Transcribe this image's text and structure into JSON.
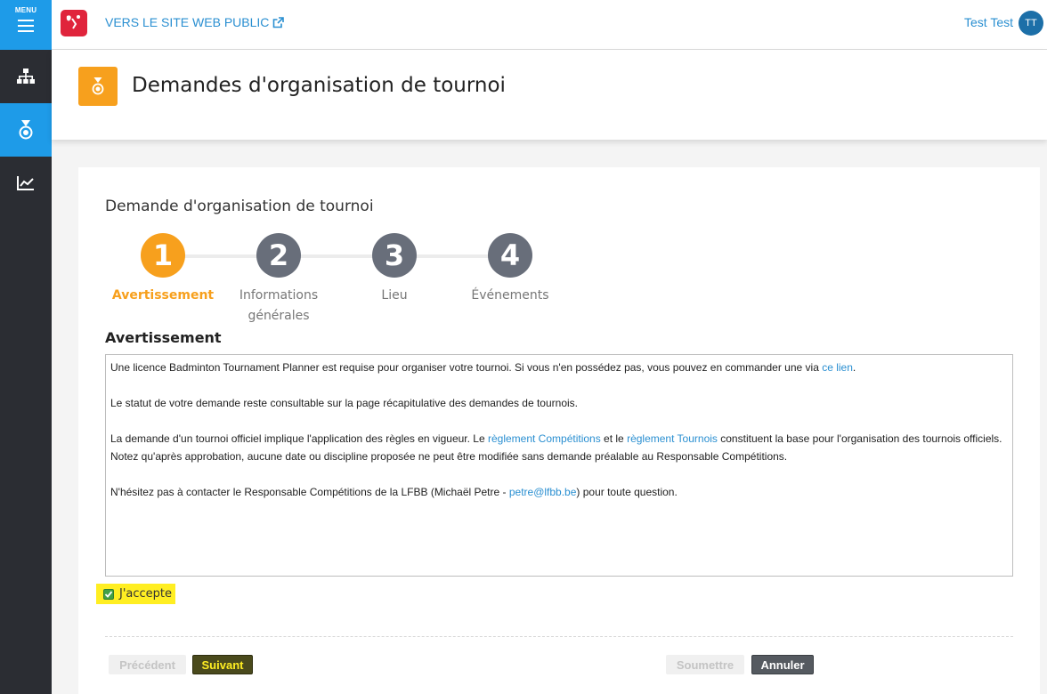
{
  "sidebar": {
    "menu_label": "MENU",
    "items": [
      {
        "icon": "sitemap-icon"
      },
      {
        "icon": "medal-icon"
      },
      {
        "icon": "line-chart-icon"
      }
    ]
  },
  "header": {
    "logo_text": "lfbb",
    "public_link": "VERS LE SITE WEB PUBLIC",
    "user_name": "Test Test",
    "user_initials": "TT"
  },
  "page": {
    "title": "Demandes d'organisation de tournoi"
  },
  "card": {
    "title": "Demande d'organisation de tournoi",
    "steps": [
      {
        "number": "1",
        "label": "Avertissement"
      },
      {
        "number": "2",
        "label": "Informations générales"
      },
      {
        "number": "3",
        "label": "Lieu"
      },
      {
        "number": "4",
        "label": "Événements"
      }
    ],
    "section_heading": "Avertissement",
    "warning": {
      "p1_text": "Une licence Badminton Tournament Planner est requise pour organiser votre tournoi. Si vous n'en possédez pas, vous pouvez en commander une via ",
      "p1_link": "ce lien",
      "p1_end": ".",
      "p2_text": "Le statut de votre demande reste consultable sur la page récapitulative des demandes de tournois.",
      "p3_a": "La demande d'un tournoi officiel implique l'application des règles en vigueur. Le ",
      "p3_link1": "règlement Compétitions",
      "p3_b": " et le ",
      "p3_link2": "règlement Tournois",
      "p3_c": " constituent la base pour l'organisation des tournois officiels. Notez qu'après approbation, aucune date ou discipline proposée ne peut être modifiée sans demande préalable au Responsable Compétitions.",
      "p4_a": "N'hésitez pas à contacter le Responsable Compétitions de la LFBB (Michaël Petre - ",
      "p4_link": "petre@lfbb.be",
      "p4_b": ") pour toute question."
    },
    "accept_label": "J'accepte",
    "buttons": {
      "previous": "Précédent",
      "next": "Suivant",
      "submit": "Soumettre",
      "cancel": "Annuler"
    }
  }
}
